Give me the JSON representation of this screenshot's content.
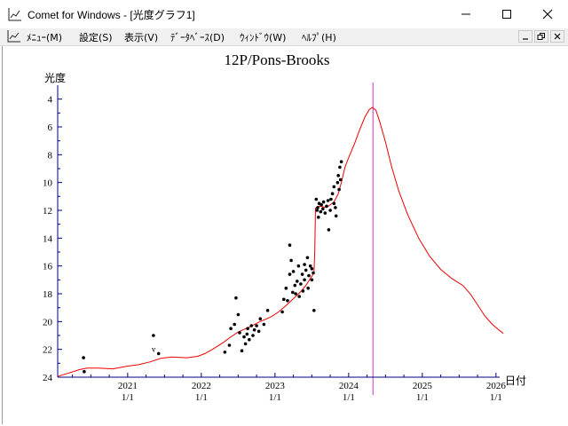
{
  "window": {
    "title": "Comet for Windows - [光度グラフ1]",
    "minimize_glyph": "—",
    "maximize_glyph": "☐",
    "close_glyph": "✕"
  },
  "menu": {
    "items": [
      {
        "label": "ﾒﾆｭｰ(M)"
      },
      {
        "label": "設定(S)"
      },
      {
        "label": "表示(V)"
      },
      {
        "label": "ﾃﾞｰﾀﾍﾞｰｽ(D)"
      },
      {
        "label": "ｳｨﾝﾄﾞｳ(W)"
      },
      {
        "label": "ﾍﾙﾌﾟ(H)"
      }
    ]
  },
  "chart_data": {
    "type": "scatter",
    "title": "12P/Pons-Brooks",
    "ylabel": "光度",
    "xlabel": "日付",
    "y_inverted": true,
    "ylim": [
      24,
      3
    ],
    "y_ticks": [
      4,
      6,
      8,
      10,
      12,
      14,
      16,
      18,
      20,
      22,
      24
    ],
    "xlim": [
      2020.05,
      2026.05
    ],
    "x_ticks": [
      {
        "x": 2021,
        "year": "2021",
        "md": "1/1"
      },
      {
        "x": 2022,
        "year": "2022",
        "md": "1/1"
      },
      {
        "x": 2023,
        "year": "2023",
        "md": "1/1"
      },
      {
        "x": 2024,
        "year": "2024",
        "md": "1/1"
      },
      {
        "x": 2025,
        "year": "2025",
        "md": "1/1"
      },
      {
        "x": 2026,
        "year": "2026",
        "md": "1/1"
      }
    ],
    "perihelion_line_x": 2024.33,
    "colors": {
      "curve": "#ee0000",
      "perihelion": "#cc33cc",
      "points": "#000000",
      "axis": "#000080"
    },
    "predicted_curve": [
      [
        2020.05,
        23.95
      ],
      [
        2020.2,
        23.7
      ],
      [
        2020.35,
        23.45
      ],
      [
        2020.45,
        23.35
      ],
      [
        2020.6,
        23.35
      ],
      [
        2020.8,
        23.4
      ],
      [
        2021.0,
        23.2
      ],
      [
        2021.15,
        23.1
      ],
      [
        2021.3,
        22.9
      ],
      [
        2021.45,
        22.65
      ],
      [
        2021.6,
        22.55
      ],
      [
        2021.8,
        22.6
      ],
      [
        2021.95,
        22.5
      ],
      [
        2022.05,
        22.3
      ],
      [
        2022.15,
        22.0
      ],
      [
        2022.3,
        21.5
      ],
      [
        2022.4,
        21.1
      ],
      [
        2022.5,
        20.75
      ],
      [
        2022.65,
        20.4
      ],
      [
        2022.8,
        20.0
      ],
      [
        2022.95,
        19.65
      ],
      [
        2023.05,
        19.3
      ],
      [
        2023.15,
        18.85
      ],
      [
        2023.25,
        18.35
      ],
      [
        2023.35,
        17.85
      ],
      [
        2023.42,
        17.4
      ],
      [
        2023.48,
        16.9
      ],
      [
        2023.53,
        16.5
      ],
      [
        2023.54,
        14.8
      ],
      [
        2023.55,
        11.85
      ],
      [
        2023.6,
        11.7
      ],
      [
        2023.7,
        11.8
      ],
      [
        2023.8,
        11.4
      ],
      [
        2023.86,
        10.8
      ],
      [
        2023.9,
        10.0
      ],
      [
        2023.95,
        8.9
      ],
      [
        2024.0,
        8.2
      ],
      [
        2024.08,
        7.2
      ],
      [
        2024.15,
        6.2
      ],
      [
        2024.22,
        5.3
      ],
      [
        2024.28,
        4.75
      ],
      [
        2024.32,
        4.6
      ],
      [
        2024.37,
        4.8
      ],
      [
        2024.42,
        5.6
      ],
      [
        2024.5,
        7.1
      ],
      [
        2024.58,
        8.8
      ],
      [
        2024.68,
        10.6
      ],
      [
        2024.8,
        12.3
      ],
      [
        2024.95,
        14.0
      ],
      [
        2025.1,
        15.3
      ],
      [
        2025.25,
        16.25
      ],
      [
        2025.4,
        16.9
      ],
      [
        2025.55,
        17.4
      ],
      [
        2025.65,
        18.0
      ],
      [
        2025.75,
        18.8
      ],
      [
        2025.85,
        19.6
      ],
      [
        2025.95,
        20.2
      ],
      [
        2026.05,
        20.65
      ],
      [
        2026.1,
        20.85
      ]
    ],
    "observations": [
      [
        2020.4,
        22.6
      ],
      [
        2020.41,
        23.6
      ],
      [
        2021.35,
        21.0
      ],
      [
        2021.42,
        22.3
      ],
      [
        2022.32,
        22.2
      ],
      [
        2022.38,
        21.7
      ],
      [
        2022.4,
        20.5
      ],
      [
        2022.45,
        20.2
      ],
      [
        2022.47,
        18.3
      ],
      [
        2022.5,
        19.5
      ],
      [
        2022.52,
        20.8
      ],
      [
        2022.55,
        22.1
      ],
      [
        2022.58,
        21.1
      ],
      [
        2022.6,
        21.6
      ],
      [
        2022.62,
        20.9
      ],
      [
        2022.63,
        20.5
      ],
      [
        2022.65,
        21.3
      ],
      [
        2022.68,
        20.3
      ],
      [
        2022.7,
        21.0
      ],
      [
        2022.72,
        20.6
      ],
      [
        2022.75,
        20.3
      ],
      [
        2022.78,
        20.7
      ],
      [
        2022.8,
        19.8
      ],
      [
        2022.85,
        20.2
      ],
      [
        2022.9,
        19.2
      ],
      [
        2023.1,
        19.3
      ],
      [
        2023.12,
        18.4
      ],
      [
        2023.15,
        17.6
      ],
      [
        2023.17,
        18.5
      ],
      [
        2023.2,
        14.5
      ],
      [
        2023.2,
        16.6
      ],
      [
        2023.22,
        15.6
      ],
      [
        2023.24,
        17.9
      ],
      [
        2023.25,
        16.4
      ],
      [
        2023.27,
        17.4
      ],
      [
        2023.28,
        18.0
      ],
      [
        2023.3,
        17.1
      ],
      [
        2023.32,
        16.0
      ],
      [
        2023.33,
        18.2
      ],
      [
        2023.35,
        17.3
      ],
      [
        2023.37,
        16.6
      ],
      [
        2023.38,
        17.8
      ],
      [
        2023.4,
        15.9
      ],
      [
        2023.4,
        17.0
      ],
      [
        2023.42,
        16.3
      ],
      [
        2023.44,
        15.4
      ],
      [
        2023.45,
        17.6
      ],
      [
        2023.46,
        16.7
      ],
      [
        2023.48,
        16.0
      ],
      [
        2023.5,
        17.0
      ],
      [
        2023.5,
        16.2
      ],
      [
        2023.52,
        16.5
      ],
      [
        2023.53,
        19.2
      ],
      [
        2023.56,
        11.2
      ],
      [
        2023.57,
        12.0
      ],
      [
        2023.58,
        11.8
      ],
      [
        2023.59,
        12.5
      ],
      [
        2023.6,
        11.5
      ],
      [
        2023.62,
        12.1
      ],
      [
        2023.63,
        11.6
      ],
      [
        2023.65,
        11.9
      ],
      [
        2023.66,
        11.4
      ],
      [
        2023.68,
        12.2
      ],
      [
        2023.7,
        11.7
      ],
      [
        2023.72,
        11.3
      ],
      [
        2023.73,
        13.4
      ],
      [
        2023.75,
        12.0
      ],
      [
        2023.76,
        11.2
      ],
      [
        2023.78,
        10.8
      ],
      [
        2023.8,
        11.5
      ],
      [
        2023.8,
        10.3
      ],
      [
        2023.82,
        11.8
      ],
      [
        2023.83,
        12.4
      ],
      [
        2023.85,
        10.0
      ],
      [
        2023.86,
        9.5
      ],
      [
        2023.87,
        10.5
      ],
      [
        2023.88,
        8.9
      ],
      [
        2023.89,
        9.8
      ],
      [
        2023.9,
        8.5
      ]
    ],
    "marker_v": {
      "x": 2021.35,
      "y": 22.0,
      "label": "v"
    }
  }
}
